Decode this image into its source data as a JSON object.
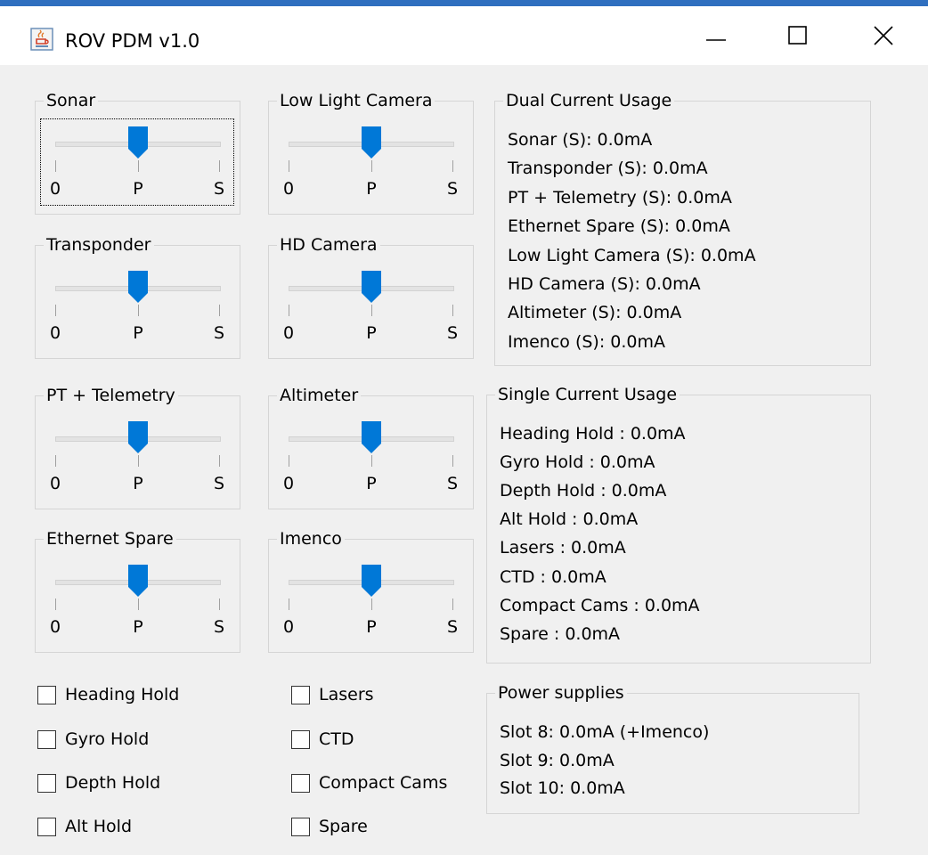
{
  "window": {
    "title": "ROV PDM v1.0",
    "icon": "java-cup-icon",
    "controls": [
      "minimize-icon",
      "maximize-icon",
      "close-icon"
    ]
  },
  "sliders": [
    {
      "label": "Sonar",
      "ticks": [
        "0",
        "P",
        "S"
      ],
      "value": "P",
      "focused": true
    },
    {
      "label": "Low Light Camera",
      "ticks": [
        "0",
        "P",
        "S"
      ],
      "value": "P"
    },
    {
      "label": "Transponder",
      "ticks": [
        "0",
        "P",
        "S"
      ],
      "value": "P"
    },
    {
      "label": "HD Camera",
      "ticks": [
        "0",
        "P",
        "S"
      ],
      "value": "P"
    },
    {
      "label": "PT + Telemetry",
      "ticks": [
        "0",
        "P",
        "S"
      ],
      "value": "P"
    },
    {
      "label": "Altimeter",
      "ticks": [
        "0",
        "P",
        "S"
      ],
      "value": "P"
    },
    {
      "label": "Ethernet Spare",
      "ticks": [
        "0",
        "P",
        "S"
      ],
      "value": "P"
    },
    {
      "label": "Imenco",
      "ticks": [
        "0",
        "P",
        "S"
      ],
      "value": "P"
    }
  ],
  "dual": {
    "title": "Dual Current Usage",
    "lines": [
      "Sonar (S): 0.0mA",
      "Transponder (S): 0.0mA",
      "PT + Telemetry (S): 0.0mA",
      "Ethernet Spare (S): 0.0mA",
      "Low Light Camera (S): 0.0mA",
      "HD Camera (S): 0.0mA",
      "Altimeter (S): 0.0mA",
      "Imenco (S): 0.0mA"
    ]
  },
  "single": {
    "title": "Single Current Usage",
    "lines": [
      "Heading Hold : 0.0mA",
      "Gyro Hold : 0.0mA",
      "Depth Hold : 0.0mA",
      "Alt Hold : 0.0mA",
      "Lasers : 0.0mA",
      "CTD : 0.0mA",
      "Compact Cams : 0.0mA",
      "Spare : 0.0mA"
    ]
  },
  "power": {
    "title": "Power supplies",
    "lines": [
      "Slot 8: 0.0mA (+Imenco)",
      "Slot 9: 0.0mA",
      "Slot 10: 0.0mA"
    ]
  },
  "checkboxes": [
    {
      "label": "Heading Hold",
      "checked": false
    },
    {
      "label": "Gyro Hold",
      "checked": false
    },
    {
      "label": "Depth Hold",
      "checked": false
    },
    {
      "label": "Alt Hold",
      "checked": false
    },
    {
      "label": "Lasers",
      "checked": false
    },
    {
      "label": "CTD",
      "checked": false
    },
    {
      "label": "Compact Cams",
      "checked": false
    },
    {
      "label": "Spare",
      "checked": false
    }
  ],
  "colors": {
    "thumb": "#0078d7",
    "titlebar_accent": "#2f6fbf"
  }
}
